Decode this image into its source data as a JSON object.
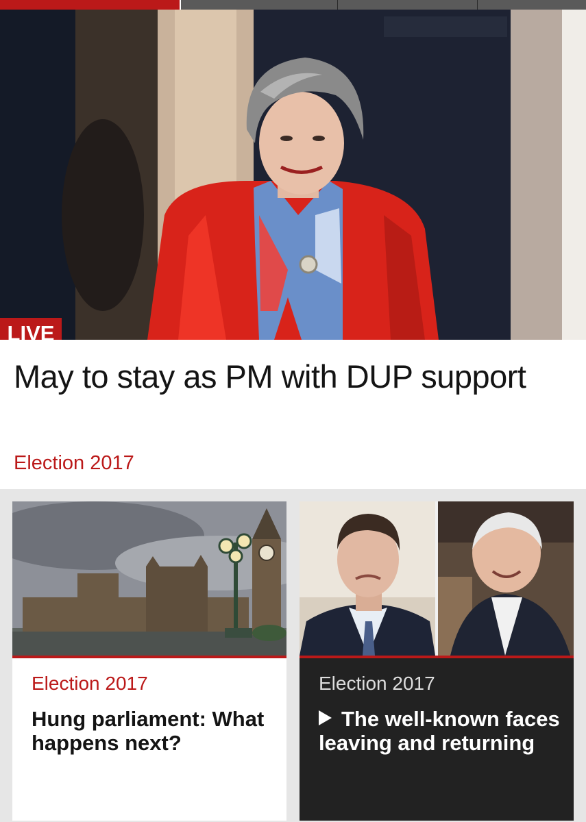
{
  "top_nav": {
    "active_index": 0,
    "segment_count": 4
  },
  "hero": {
    "image_icon": "photo-theresa-may-icon",
    "badge": "LIVE",
    "headline": "May to stay as PM with DUP support",
    "kicker": "Election 2017"
  },
  "stories": [
    {
      "image_icon": "photo-houses-of-parliament-icon",
      "kicker": "Election 2017",
      "title": "Hung parliament: What happens next?",
      "is_video": false
    },
    {
      "image_icon": "photo-clegg-and-cable-icon",
      "kicker": "Election 2017",
      "title": "The well-known faces leaving and returning",
      "is_video": true
    }
  ],
  "colors": {
    "accent_red": "#bb1919",
    "dark_card": "#222222",
    "page_bg": "#e6e6e6"
  }
}
